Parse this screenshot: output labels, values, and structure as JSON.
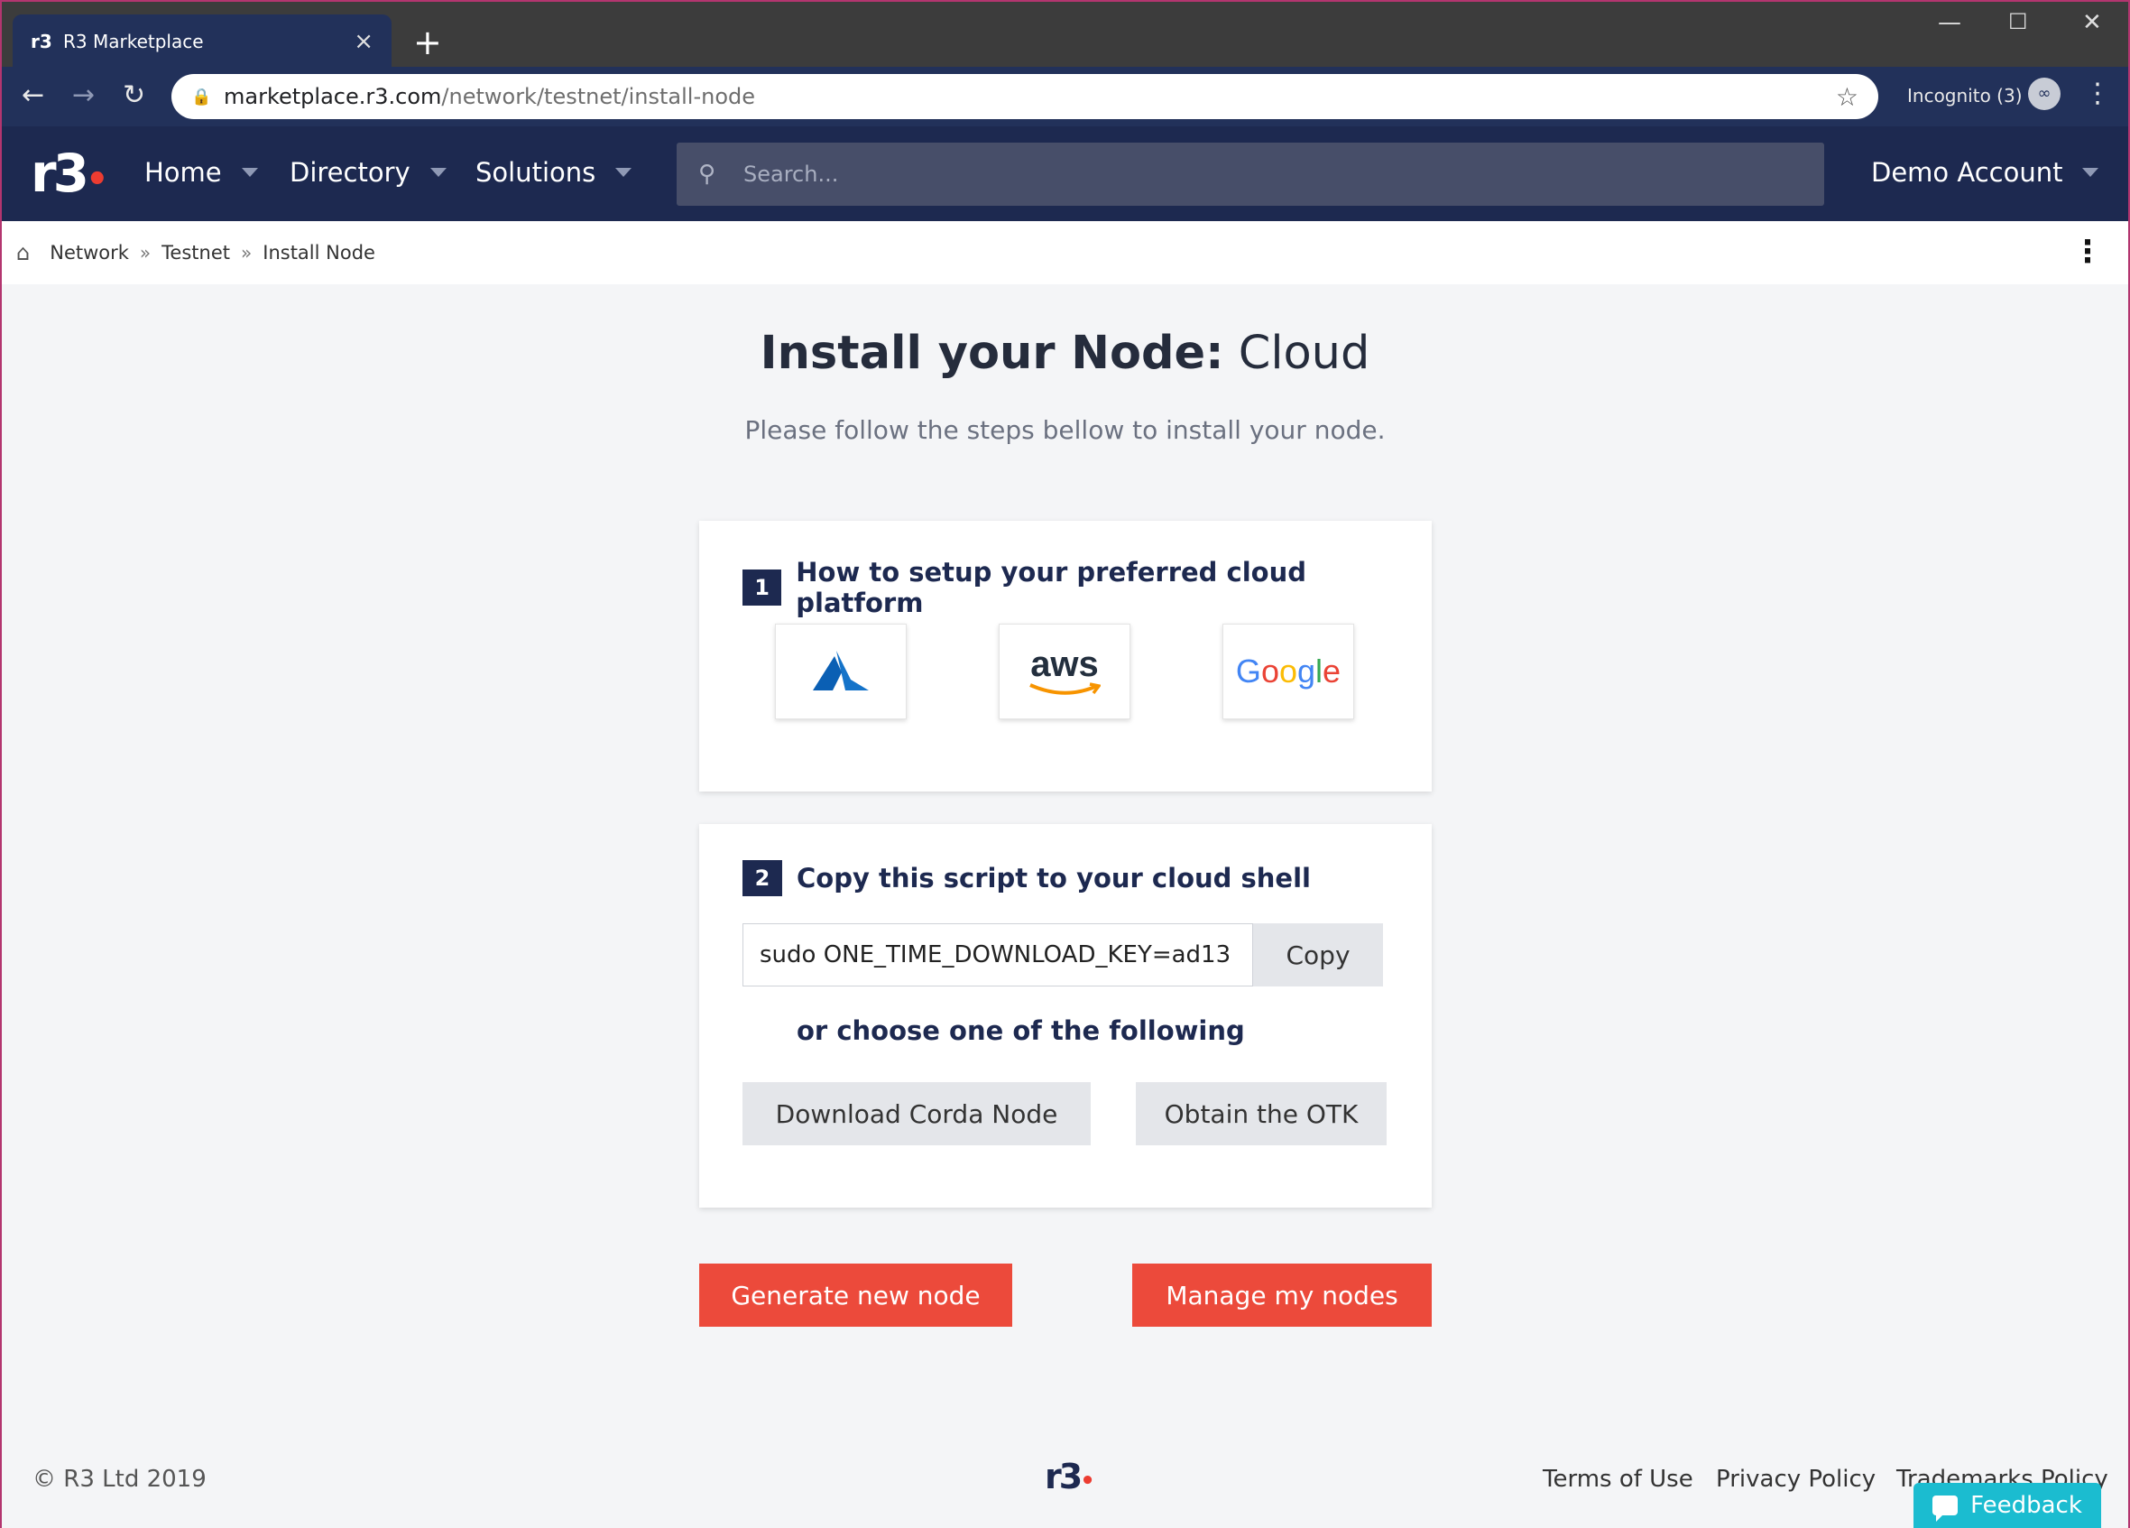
{
  "browser": {
    "tab_title": "R3 Marketplace",
    "tab_favicon": "r3",
    "url_host": "marketplace.r3.com",
    "url_path": "/network/testnet/install-node",
    "incognito_label": "Incognito (3)"
  },
  "header": {
    "logo": "r3",
    "nav": [
      {
        "label": "Home"
      },
      {
        "label": "Directory"
      },
      {
        "label": "Solutions"
      }
    ],
    "search_placeholder": "Search...",
    "account_label": "Demo Account"
  },
  "breadcrumb": [
    "Network",
    "Testnet",
    "Install Node"
  ],
  "main": {
    "title_strong": "Install your Node:",
    "title_light": "Cloud",
    "subtitle": "Please follow the steps bellow to install your node.",
    "step1": {
      "number": "1",
      "label": "How to setup your preferred cloud platform",
      "providers": [
        "azure-icon",
        "aws",
        "Google"
      ]
    },
    "step2": {
      "number": "2",
      "label": "Copy this script to your cloud shell",
      "script_value": "sudo ONE_TIME_DOWNLOAD_KEY=ad13",
      "copy_label": "Copy",
      "or_text": "or choose one of the following",
      "download_label": "Download Corda Node",
      "otk_label": "Obtain the OTK"
    },
    "generate_label": "Generate new node",
    "manage_label": "Manage my nodes"
  },
  "footer": {
    "copyright": "© R3 Ltd 2019",
    "logo": "r3",
    "links": [
      "Terms of Use",
      "Privacy Policy",
      "Trademarks Policy"
    ],
    "feedback_label": "Feedback"
  },
  "colors": {
    "navy": "#1d2950",
    "accent_red": "#ec4a3b",
    "feedback_cyan": "#1bbcd0"
  }
}
